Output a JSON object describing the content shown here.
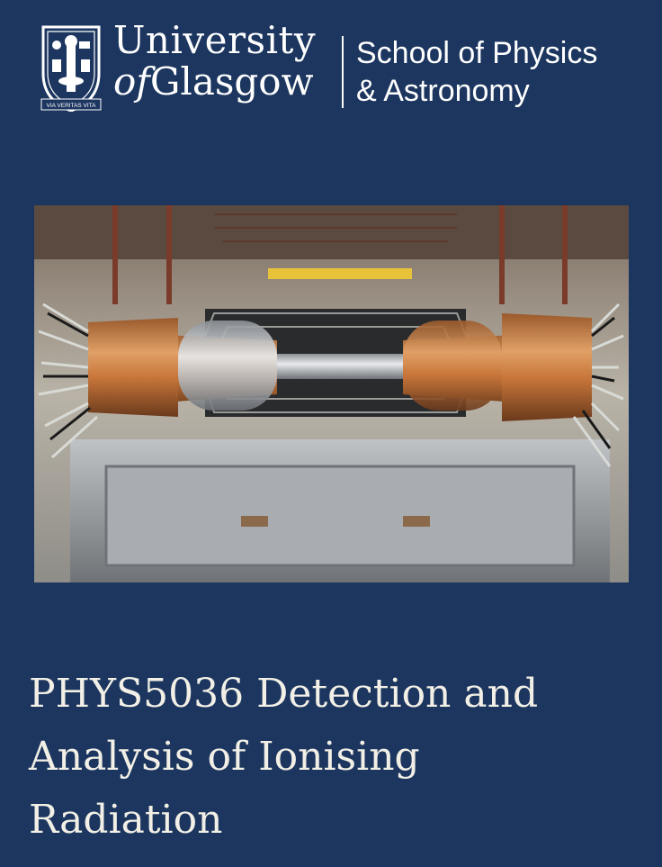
{
  "header": {
    "university_line1": "University",
    "university_of": "of",
    "university_line2": "Glasgow",
    "motto": "VIA VERITAS VITA",
    "school_line1": "School of Physics",
    "school_line2": "& Astronomy"
  },
  "title": {
    "line1": "PHYS5036 Detection and",
    "line2": "Analysis of Ionising",
    "line3": "Radiation"
  },
  "colors": {
    "background": "#1c365f",
    "title_text": "#f2efe6",
    "copper": "#c8763a",
    "gold": "#e0a030"
  }
}
